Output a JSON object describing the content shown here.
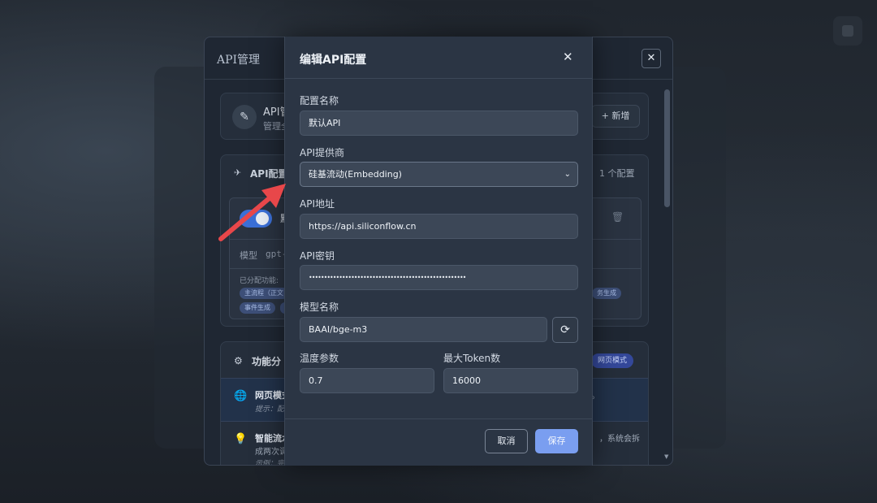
{
  "background": {
    "corner_button_icon": "square-icon"
  },
  "manager_panel": {
    "title": "API管理",
    "close_symbol": "✕",
    "info": {
      "icon": "plug-icon",
      "title": "API管",
      "subtitle": "管理全",
      "new_button": "+ 新增"
    },
    "configs": {
      "icon": "rocket-icon",
      "title": "API配置",
      "count": "1 个配置",
      "card": {
        "name": "默",
        "model_label": "模型",
        "model_value": "gpt-",
        "assigned_label": "已分配功能:",
        "tags": [
          "主流程（正文",
          "事件生成",
          "",
          "",
          "",
          "务生成"
        ]
      }
    },
    "functions": {
      "icon": "gear-icon",
      "title": "功能分",
      "mode_badge": "网页模式",
      "web_mode": {
        "icon": "globe-icon",
        "title": "网页模式",
        "hint": "提示：配",
        "trailing": "。"
      },
      "smart": {
        "icon": "bulb-icon",
        "title": "智能流水",
        "subtitle": "成两次调",
        "example": "示例：完成",
        "right_text": "，系统会拆"
      }
    }
  },
  "dialog": {
    "title": "编辑API配置",
    "close_symbol": "✕",
    "fields": {
      "config_name": {
        "label": "配置名称",
        "value": "默认API"
      },
      "provider": {
        "label": "API提供商",
        "value": "硅基流动(Embedding)"
      },
      "api_url": {
        "label": "API地址",
        "value": "https://api.siliconflow.cn"
      },
      "api_key": {
        "label": "API密钥",
        "value": "••••••••••••••••••••••••••••••••••••••••••••••••••••"
      },
      "model_name": {
        "label": "模型名称",
        "value": "BAAI/bge-m3"
      },
      "temperature": {
        "label": "温度参数",
        "value": "0.7"
      },
      "max_tokens": {
        "label": "最大Token数",
        "value": "16000"
      }
    },
    "cancel_button": "取消",
    "save_button": "保存",
    "refresh_icon": "refresh-icon"
  },
  "colors": {
    "accent": "#7a9ef0",
    "annotation_arrow": "#e8474a",
    "toggle_on": "#3b6fd6"
  }
}
